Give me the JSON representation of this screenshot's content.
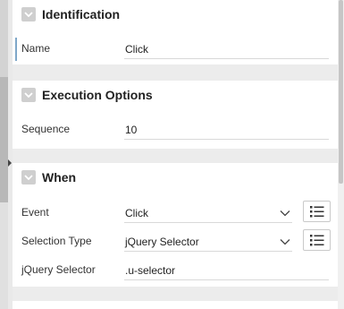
{
  "sections": {
    "identification": {
      "title": "Identification",
      "fields": {
        "name": {
          "label": "Name",
          "value": "Click"
        }
      }
    },
    "execution": {
      "title": "Execution Options",
      "fields": {
        "sequence": {
          "label": "Sequence",
          "value": "10"
        }
      }
    },
    "when": {
      "title": "When",
      "fields": {
        "event": {
          "label": "Event",
          "value": "Click"
        },
        "selection_type": {
          "label": "Selection Type",
          "value": "jQuery Selector"
        },
        "jquery_selector": {
          "label": "jQuery Selector",
          "value": ".u-selector"
        }
      }
    }
  },
  "icons": {
    "collapse": "chevron-down-icon",
    "dropdown": "chevron-down-icon",
    "list": "list-icon"
  },
  "colors": {
    "active_marker": "#7fa8c9",
    "toggle_bg": "#cfcfcf"
  }
}
